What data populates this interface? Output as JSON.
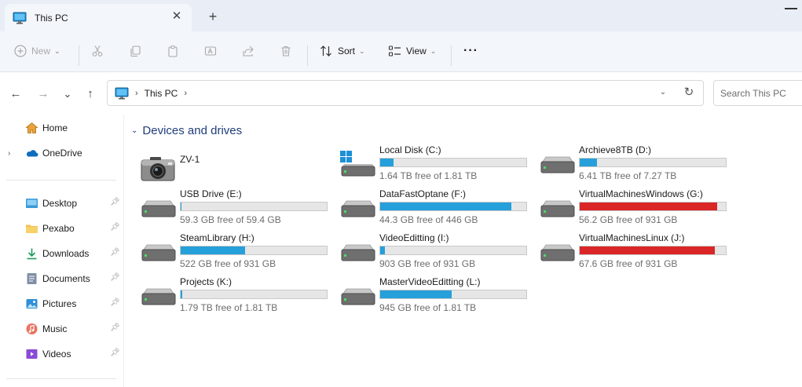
{
  "tab": {
    "title": "This PC",
    "close": "✕",
    "new_tab": "+"
  },
  "toolbar": {
    "new_label": "New",
    "sort_label": "Sort",
    "view_label": "View",
    "more_label": "···"
  },
  "nav": {
    "back": "←",
    "forward": "→",
    "recent": "⌄",
    "up": "↑"
  },
  "address": {
    "crumbs": [
      "This PC"
    ],
    "refresh": "↻"
  },
  "search": {
    "placeholder": "Search This PC"
  },
  "sidebar": {
    "top": [
      {
        "label": "Home",
        "icon": "home-icon"
      },
      {
        "label": "OneDrive",
        "icon": "onedrive-icon"
      }
    ],
    "quick": [
      {
        "label": "Desktop",
        "icon": "desktop-icon"
      },
      {
        "label": "Pexabo",
        "icon": "folder-icon"
      },
      {
        "label": "Downloads",
        "icon": "download-icon"
      },
      {
        "label": "Documents",
        "icon": "documents-icon"
      },
      {
        "label": "Pictures",
        "icon": "pictures-icon"
      },
      {
        "label": "Music",
        "icon": "music-icon"
      },
      {
        "label": "Videos",
        "icon": "videos-icon"
      }
    ]
  },
  "main": {
    "group_title": "Devices and drives",
    "device": {
      "name": "ZV-1",
      "icon": "camera-icon"
    },
    "drives": [
      {
        "name": "Local Disk (C:)",
        "free": "1.64 TB free of 1.81 TB",
        "used_fraction": 0.094,
        "windows": true
      },
      {
        "name": "Archieve8TB (D:)",
        "free": "6.41 TB free of 7.27 TB",
        "used_fraction": 0.118
      },
      {
        "name": "USB Drive (E:)",
        "free": "59.3 GB free of 59.4 GB",
        "used_fraction": 0.002
      },
      {
        "name": "DataFastOptane (F:)",
        "free": "44.3 GB free of 446 GB",
        "used_fraction": 0.9
      },
      {
        "name": "VirtualMachinesWindows (G:)",
        "free": "56.2 GB free of 931 GB",
        "used_fraction": 0.94,
        "low": true
      },
      {
        "name": "SteamLibrary (H:)",
        "free": "522 GB free of 931 GB",
        "used_fraction": 0.439
      },
      {
        "name": "VideoEditting (I:)",
        "free": "903 GB free of 931 GB",
        "used_fraction": 0.03
      },
      {
        "name": "VirtualMachinesLinux (J:)",
        "free": "67.6 GB free of 931 GB",
        "used_fraction": 0.927,
        "low": true
      },
      {
        "name": "Projects (K:)",
        "free": "1.79 TB free of 1.81 TB",
        "used_fraction": 0.011
      },
      {
        "name": "MasterVideoEditting (L:)",
        "free": "945 GB free of 1.81 TB",
        "used_fraction": 0.49
      }
    ]
  },
  "colors": {
    "bar_normal": "#26a0da",
    "bar_low": "#da2626",
    "group_title": "#1f3d7a"
  }
}
